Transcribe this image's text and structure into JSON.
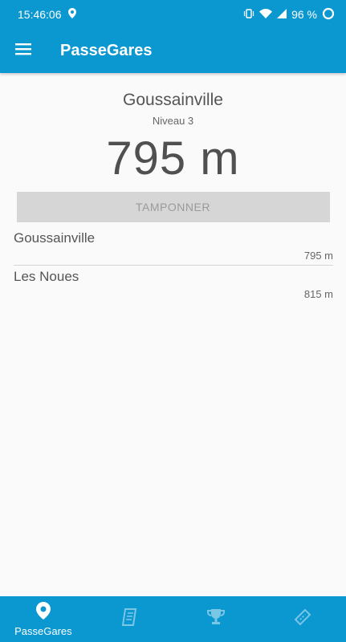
{
  "status_bar": {
    "time": "15:46:06",
    "battery": "96 %"
  },
  "app_bar": {
    "title": "PasseGares"
  },
  "station": {
    "name": "Goussainville",
    "level": "Niveau 3",
    "distance": "795 m"
  },
  "stamp_button": {
    "label": "TAMPONNER"
  },
  "nearby": [
    {
      "name": "Goussainville",
      "distance": "795 m"
    },
    {
      "name": "Les Noues",
      "distance": "815 m"
    }
  ],
  "bottom_nav": {
    "items": [
      {
        "label": "PasseGares",
        "icon": "location-pin-icon",
        "active": true
      },
      {
        "label": "",
        "icon": "book-icon",
        "active": false
      },
      {
        "label": "",
        "icon": "trophy-icon",
        "active": false
      },
      {
        "label": "",
        "icon": "ticket-icon",
        "active": false
      }
    ]
  },
  "colors": {
    "primary": "#0b97d0",
    "button_disabled": "#d6d6d6"
  }
}
